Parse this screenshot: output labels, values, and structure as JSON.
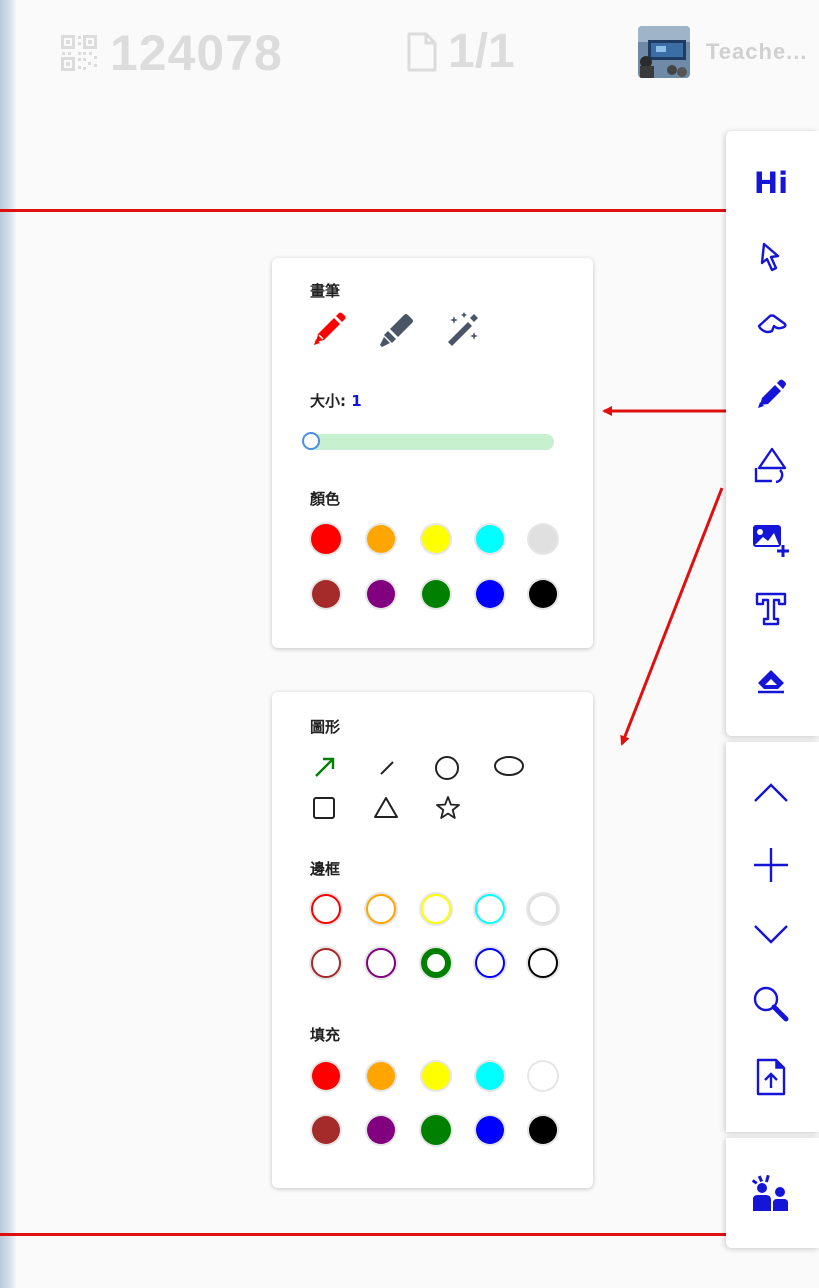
{
  "header": {
    "room_code": "124078",
    "page_indicator": "1/1",
    "user_name": "Teache..."
  },
  "pen_panel": {
    "title": "畫筆",
    "tools": [
      "pen-icon",
      "highlighter-icon",
      "magic-wand-icon"
    ],
    "selected_tool": "pen-icon",
    "size_label": "大小:",
    "size_value": "1",
    "color_label": "顏色",
    "colors": [
      "#ff0000",
      "#ffa500",
      "#ffff00",
      "#00ffff",
      "#e0e0e0",
      "#a52a2a",
      "#800080",
      "#008000",
      "#0000ff",
      "#000000"
    ],
    "selected_color": "#ff0000"
  },
  "shape_panel": {
    "title": "圖形",
    "shapes": [
      "arrow-icon",
      "line-icon",
      "circle-icon",
      "ellipse-icon",
      "square-icon",
      "triangle-icon",
      "star-icon"
    ],
    "selected_shape": "arrow-icon",
    "border_label": "邊框",
    "border_colors": [
      "#ff0000",
      "#ffa500",
      "#ffff00",
      "#00ffff",
      "#e0e0e0",
      "#a52a2a",
      "#800080",
      "#008000",
      "#0000ff",
      "#000000"
    ],
    "selected_border": "#008000",
    "fill_label": "填充",
    "fill_colors": [
      "#ff0000",
      "#ffa500",
      "#ffff00",
      "#00ffff",
      "#ffffff",
      "#a52a2a",
      "#800080",
      "#008000",
      "#0000ff",
      "#000000"
    ],
    "selected_fill": "#008000"
  },
  "toolbar": {
    "hi_label": "Hi",
    "tools": [
      "pointer-icon",
      "lasso-icon",
      "pen-icon",
      "shapes-icon",
      "add-image-icon",
      "text-icon",
      "eraser-icon"
    ],
    "nav": [
      "previous-page-icon",
      "add-page-icon",
      "next-page-icon",
      "zoom-icon",
      "upload-file-icon"
    ],
    "extra": [
      "raise-hand-icon"
    ]
  },
  "colors": {
    "accent": "#1515d8",
    "annotation_red": "#e01010",
    "slider_track": "#c7f0cf",
    "slider_thumb_border": "#4a90e2"
  }
}
